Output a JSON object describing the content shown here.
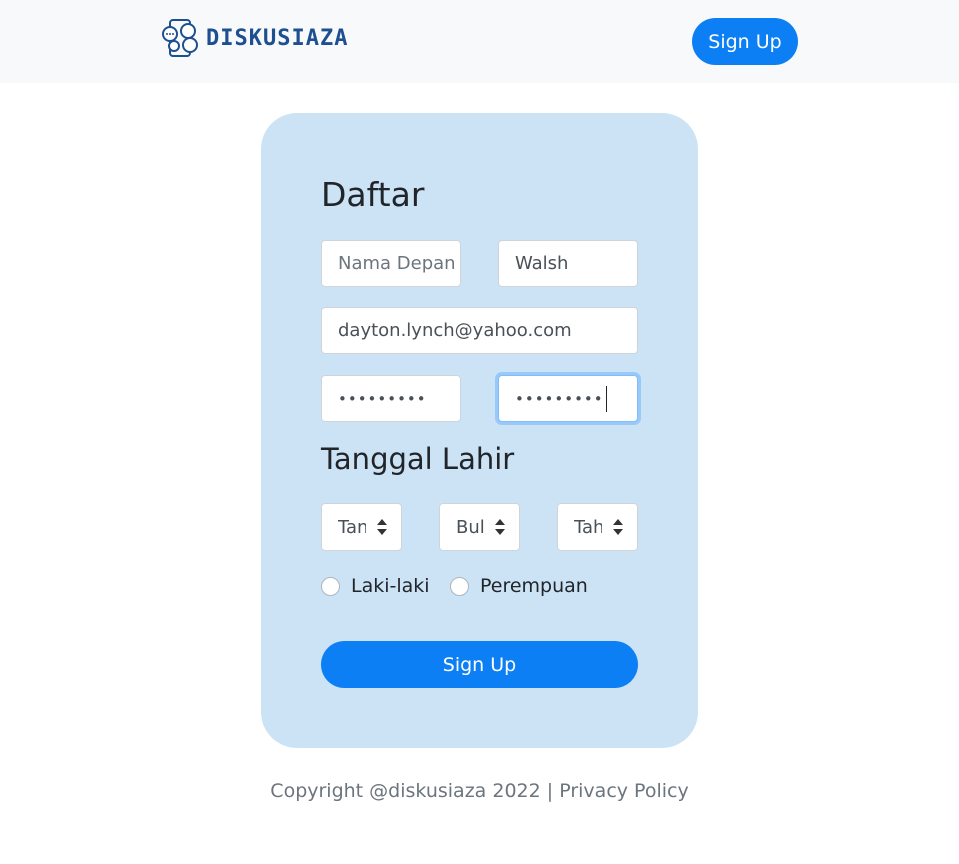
{
  "navbar": {
    "brand_text": "DISKUSIAZA",
    "signup_label": "Sign Up"
  },
  "form": {
    "title": "Daftar",
    "first_name": {
      "value": "",
      "placeholder": "Nama Depan"
    },
    "last_name": {
      "value": "Walsh"
    },
    "email": {
      "value": "dayton.lynch@yahoo.com"
    },
    "password_mask": "•••••••••",
    "confirm_password_mask": "•••••••••",
    "birthdate_label": "Tanggal Lahir",
    "day_select": "Tanggal",
    "month_select": "Bulan",
    "year_select": "Tahun",
    "gender_options": [
      "Laki-laki",
      "Perempuan"
    ],
    "submit_label": "Sign Up"
  },
  "footer": {
    "copyright": "Copyright @diskusiaza 2022",
    "separator": "|",
    "privacy_link": "Privacy Policy"
  },
  "colors": {
    "primary": "#0d7ff5",
    "card_bg": "#cce3f6",
    "navbar_bg": "#f8f9fa",
    "brand": "#1d4f91"
  }
}
